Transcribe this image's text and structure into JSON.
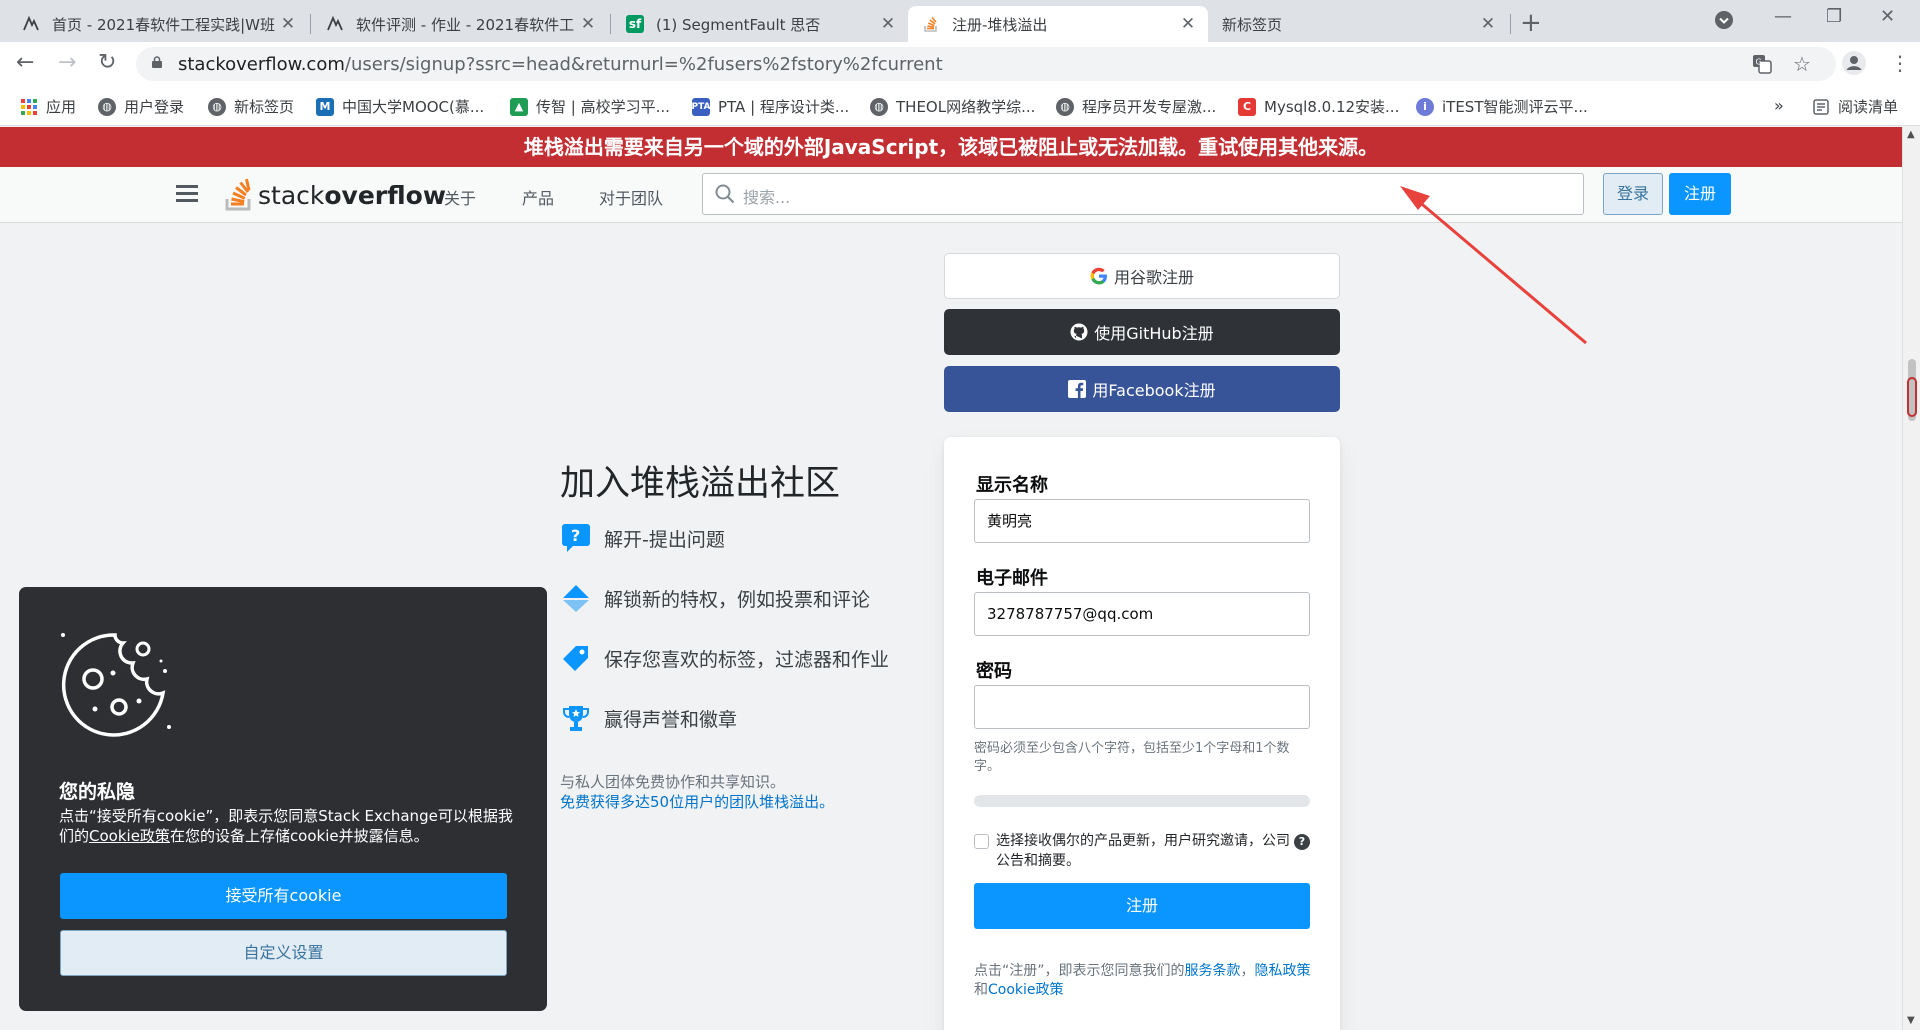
{
  "browser": {
    "tabs": [
      {
        "title": "首页 - 2021春软件工程实践|W班",
        "favicon": "cnblogs-icon"
      },
      {
        "title": "软件评测 - 作业 - 2021春软件工",
        "favicon": "cnblogs-icon"
      },
      {
        "title": "(1) SegmentFault 思否",
        "favicon": "segmentfault-icon"
      },
      {
        "title": "注册-堆栈溢出",
        "favicon": "stackoverflow-icon"
      },
      {
        "title": "新标签页",
        "favicon": ""
      }
    ],
    "url_host": "stackoverflow.com",
    "url_rest": "/users/signup?ssrc=head&returnurl=%2fusers%2fstory%2fcurrent",
    "bookmarks": [
      {
        "label": "应用",
        "icon": "apps-icon"
      },
      {
        "label": "用户登录",
        "icon": "globe-icon"
      },
      {
        "label": "新标签页",
        "icon": "globe-icon"
      },
      {
        "label": "中国大学MOOC(慕...",
        "icon": "mooc-icon"
      },
      {
        "label": "传智 | 高校学习平...",
        "icon": "chuanzhi-icon"
      },
      {
        "label": "PTA | 程序设计类...",
        "icon": "pta-icon"
      },
      {
        "label": "THEOL网络教学综...",
        "icon": "globe-icon"
      },
      {
        "label": "程序员开发专屋激...",
        "icon": "globe-icon"
      },
      {
        "label": "Mysql8.0.12安装...",
        "icon": "csdn-icon"
      },
      {
        "label": "iTEST智能测评云平...",
        "icon": "itest-icon"
      }
    ],
    "bookmarks_more": "»",
    "reading_list": "阅读清单"
  },
  "warning_banner": "堆栈溢出需要来自另一个域的外部JavaScript，该域已被阻止或无法加载。重试使用其他来源。",
  "topbar": {
    "logo_light": "stack",
    "logo_bold": "overflow",
    "nav": [
      "关于",
      "产品",
      "对于团队"
    ],
    "search_placeholder": "搜索...",
    "login": "登录",
    "signup": "注册"
  },
  "oauth": {
    "google": "用谷歌注册",
    "github": "使用GitHub注册",
    "facebook": "用Facebook注册"
  },
  "pitch": {
    "title": "加入堆栈溢出社区",
    "items": [
      "解开-提出问题",
      "解锁新的特权，例如投票和评论",
      "保存您喜欢的标签，过滤器和作业",
      "赢得声誉和徽章"
    ],
    "note_line1": "与私人团体免费协作和共享知识。",
    "note_link": "免费获得多达50位用户的团队堆栈溢出。"
  },
  "form": {
    "display_name_label": "显示名称",
    "display_name_value": "黄明亮",
    "email_label": "电子邮件",
    "email_value": "3278787757@qq.com",
    "password_label": "密码",
    "password_value": "",
    "password_hint": "密码必须至少包含八个字符，包括至少1个字母和1个数字。",
    "opt_in": "选择接收偶尔的产品更新，用户研究邀请，公司公告和摘要。",
    "help": "?",
    "submit": "注册",
    "legal_prefix": "点击“注册”，即表示您同意我们的",
    "legal_terms": "服务条款",
    "legal_sep": "，",
    "legal_privacy": "隐私政策",
    "legal_and": "和",
    "legal_cookie": "Cookie政策"
  },
  "cookie": {
    "title": "您的私隐",
    "text_before": "点击“接受所有cookie”，即表示您同意Stack Exchange可以根据我们的",
    "text_link": "Cookie政策",
    "text_after": "在您的设备上存储cookie并披露信息。",
    "accept": "接受所有cookie",
    "customize": "自定义设置"
  },
  "colors": {
    "warning": "#c22e32",
    "primary": "#0a95ff",
    "github": "#2f3337",
    "facebook": "#385499",
    "cookie_bg": "#2d2f33",
    "annotation_arrow": "#e8423d"
  }
}
